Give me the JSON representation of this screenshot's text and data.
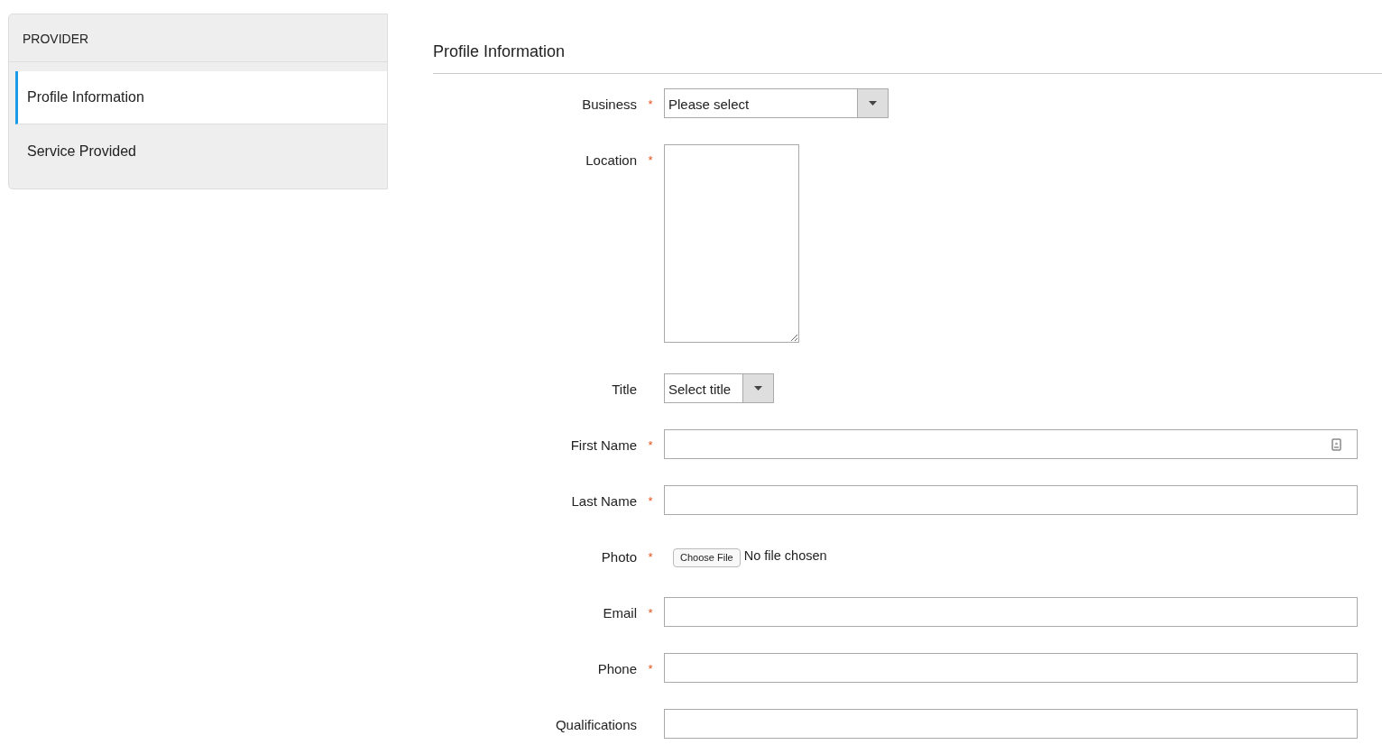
{
  "sidebar": {
    "header": "PROVIDER",
    "items": [
      {
        "label": "Profile Information",
        "selected": true
      },
      {
        "label": "Service Provided",
        "selected": false
      }
    ]
  },
  "section_title": "Profile Information",
  "fields": [
    {
      "kind": "wide_select",
      "label": "Business",
      "required_mark": "*",
      "value": "Please select"
    },
    {
      "kind": "textarea",
      "label": "Location",
      "required_mark": "*"
    },
    {
      "kind": "select",
      "label": "Title",
      "value": "Select title"
    },
    {
      "kind": "contact_text",
      "label": "First Name",
      "required_mark": "*"
    },
    {
      "kind": "text",
      "label": "Last Name",
      "required_mark": "*"
    },
    {
      "kind": "file",
      "label": "Photo",
      "required_mark": "*",
      "button": "Choose File",
      "status": "No file chosen"
    },
    {
      "kind": "text",
      "label": "Email",
      "required_mark": "*"
    },
    {
      "kind": "text",
      "label": "Phone",
      "required_mark": "*"
    },
    {
      "kind": "text",
      "label": "Qualifications"
    }
  ]
}
